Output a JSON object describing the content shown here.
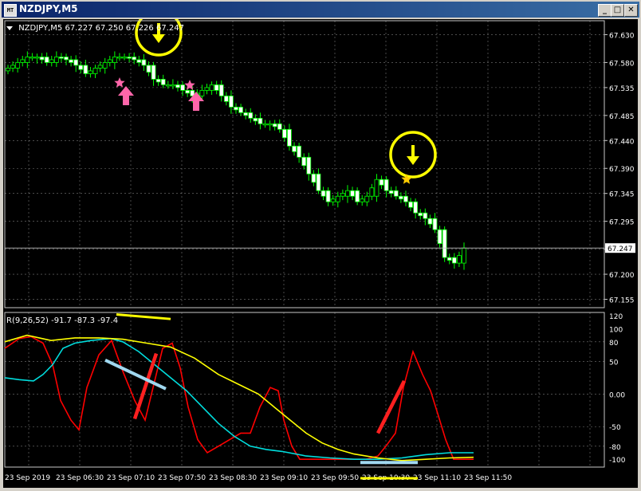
{
  "window": {
    "title": "NZDJPY,M5",
    "icon_text": "MT",
    "buttons": {
      "minimize": "_",
      "maximize": "□",
      "close": "✕"
    }
  },
  "chart": {
    "header_symbol": "NZDJPY,M5",
    "ohlc": "67.227 67.250 67.226 67.247",
    "current_price_label": "67.247",
    "price_ticks": [
      "67.630",
      "67.580",
      "67.535",
      "67.485",
      "67.440",
      "67.390",
      "67.345",
      "67.295",
      "67.245",
      "67.200",
      "67.155"
    ],
    "time_labels": [
      "23 Sep 2019",
      "23 Sep 06:30",
      "23 Sep 07:10",
      "23 Sep 07:50",
      "23 Sep 08:30",
      "23 Sep 09:10",
      "23 Sep 09:50",
      "23 Sep 10:30",
      "23 Sep 11:10",
      "23 Sep 11:50"
    ],
    "colors": {
      "bull_candle": "#00ff00",
      "bear_candle": "#ffffff",
      "grid": "#c8c8c8",
      "circle": "#ffff00",
      "arrow_up": "#ff66aa",
      "star_pink": "#ff66aa",
      "star_yellow": "#ffcc00"
    }
  },
  "indicator": {
    "label": "R(9,26,52) -91.7 -87.3 -97.4",
    "ticks": [
      "120",
      "100",
      "80",
      "50",
      "0.00",
      "-50",
      "-80",
      "-100"
    ],
    "series_colors": {
      "fast": "#ff0000",
      "mid": "#00dddd",
      "slow": "#ffff00"
    },
    "annotation_colors": {
      "red_line": "#ff2020",
      "blue_line": "#a0d8f0",
      "yellow_line": "#ffff00"
    }
  },
  "chart_data": {
    "type": "line",
    "series": [
      {
        "values": [
          67.57,
          67.58,
          67.59,
          67.59,
          67.58,
          67.59,
          67.585,
          67.575,
          67.56,
          67.57,
          67.58,
          67.59,
          67.59,
          67.585,
          67.575,
          67.55,
          67.54,
          67.54,
          67.53,
          67.52,
          67.53,
          67.54,
          67.52,
          67.5,
          67.49,
          67.48,
          67.47,
          67.47,
          67.46,
          67.43,
          67.41,
          67.38,
          67.35,
          67.33,
          67.34,
          67.35,
          67.33,
          67.34,
          67.37,
          67.35,
          67.34,
          67.33,
          67.31,
          67.3,
          67.28,
          67.23,
          67.22,
          67.247
        ]
      }
    ]
  }
}
